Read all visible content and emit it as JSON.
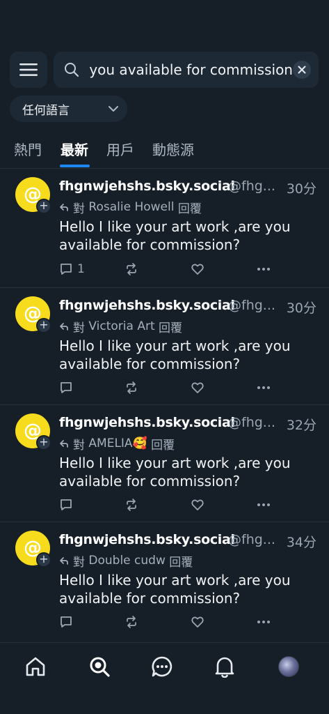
{
  "header": {
    "menu_icon": "hamburger-menu-icon",
    "search_value": "Are you available for commission?",
    "search_icon": "search-icon",
    "clear_icon": "close-icon"
  },
  "language_filter": {
    "selected": "任何語言",
    "icon": "chevron-down-icon"
  },
  "tabs": [
    {
      "label": "熱門",
      "active": false
    },
    {
      "label": "最新",
      "active": true
    },
    {
      "label": "用戶",
      "active": false
    },
    {
      "label": "動態源",
      "active": false
    }
  ],
  "posts": [
    {
      "display_name": "fhgnwjehshs.bsky.social",
      "handle": "@fhg...",
      "time": "30分",
      "reply_prefix": "對",
      "reply_to": "Rosalie Howell",
      "reply_suffix": "回覆",
      "text": "Hello I like your art work ,are you available for commission?",
      "reply_count": "1"
    },
    {
      "display_name": "fhgnwjehshs.bsky.social",
      "handle": "@fhg...",
      "time": "30分",
      "reply_prefix": "對",
      "reply_to": "Victoria Art",
      "reply_suffix": "回覆",
      "text": "Hello I like your art work ,are you available for commission?",
      "reply_count": ""
    },
    {
      "display_name": "fhgnwjehshs.bsky.social",
      "handle": "@fhg...",
      "time": "32分",
      "reply_prefix": "對",
      "reply_to": "AMELIA🥰",
      "reply_suffix": "回覆",
      "text": "Hello I like your art work ,are you available for commission?",
      "reply_count": ""
    },
    {
      "display_name": "fhgnwjehshs.bsky.social",
      "handle": "@fhg...",
      "time": "34分",
      "reply_prefix": "對",
      "reply_to": "Double cudw",
      "reply_suffix": "回覆",
      "text": "Hello I like your art work ,are you available for commission?",
      "reply_count": ""
    }
  ],
  "bottom_nav": [
    {
      "name": "home-icon"
    },
    {
      "name": "search-icon",
      "active": true
    },
    {
      "name": "chat-icon"
    },
    {
      "name": "bell-icon"
    },
    {
      "name": "profile-avatar"
    }
  ],
  "colors": {
    "background": "#161e27",
    "surface": "#1e2936",
    "accent": "#1e86f0",
    "avatar": "#f7dc1e"
  }
}
